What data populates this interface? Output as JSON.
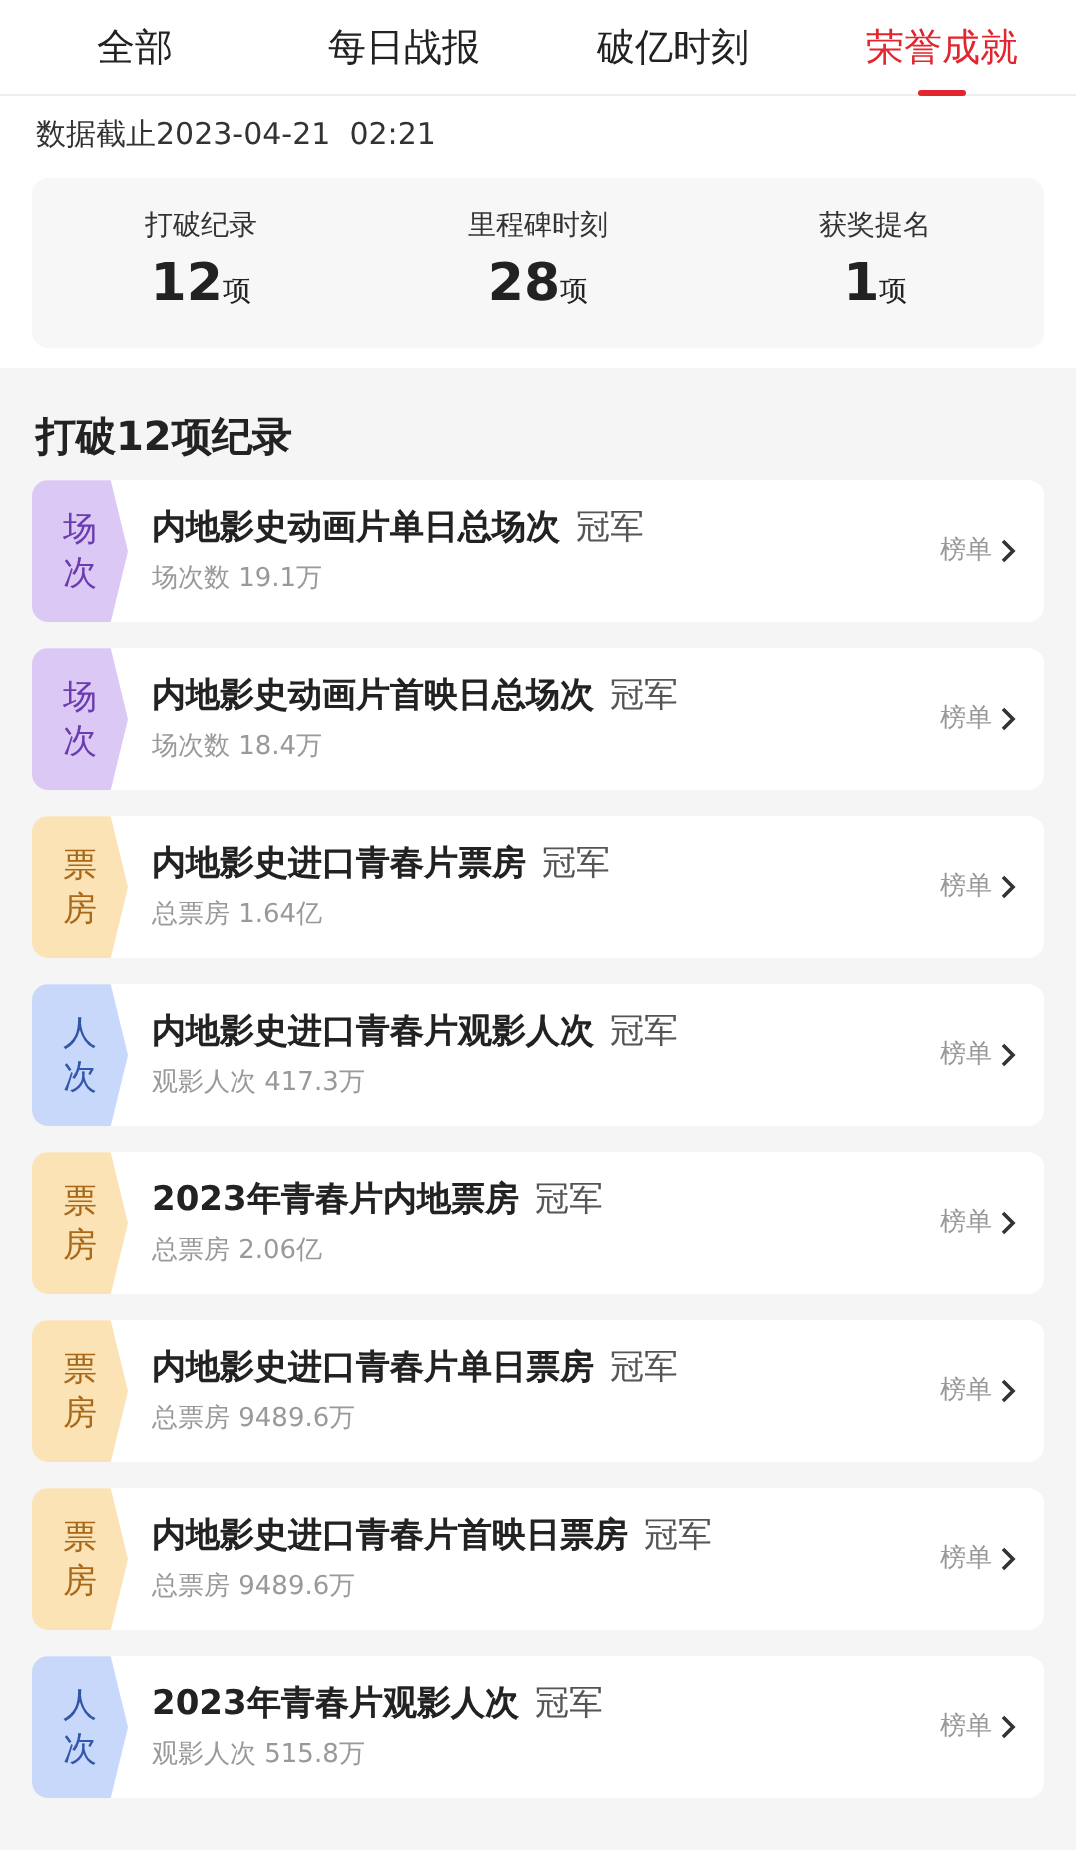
{
  "tabs": [
    {
      "label": "全部",
      "selected": false
    },
    {
      "label": "每日战报",
      "selected": false
    },
    {
      "label": "破亿时刻",
      "selected": false
    },
    {
      "label": "荣誉成就",
      "selected": true
    }
  ],
  "data_cutoff": "数据截止2023-04-21  02:21",
  "stats": [
    {
      "label": "打破纪录",
      "value": "12",
      "unit": "项"
    },
    {
      "label": "里程碑时刻",
      "value": "28",
      "unit": "项"
    },
    {
      "label": "获奖提名",
      "value": "1",
      "unit": "项"
    }
  ],
  "section_title": "打破12项纪录",
  "records": [
    {
      "kind": "screenings",
      "tag": "场次",
      "title": "内地影史动画片单日总场次",
      "rank": "冠军",
      "detail": "场次数 19.1万",
      "link": "榜单"
    },
    {
      "kind": "screenings",
      "tag": "场次",
      "title": "内地影史动画片首映日总场次",
      "rank": "冠军",
      "detail": "场次数 18.4万",
      "link": "榜单"
    },
    {
      "kind": "boxoffice",
      "tag": "票房",
      "title": "内地影史进口青春片票房",
      "rank": "冠军",
      "detail": "总票房 1.64亿",
      "link": "榜单"
    },
    {
      "kind": "admissions",
      "tag": "人次",
      "title": "内地影史进口青春片观影人次",
      "rank": "冠军",
      "detail": "观影人次 417.3万",
      "link": "榜单"
    },
    {
      "kind": "boxoffice",
      "tag": "票房",
      "title": "2023年青春片内地票房",
      "rank": "冠军",
      "detail": "总票房 2.06亿",
      "link": "榜单"
    },
    {
      "kind": "boxoffice",
      "tag": "票房",
      "title": "内地影史进口青春片单日票房",
      "rank": "冠军",
      "detail": "总票房 9489.6万",
      "link": "榜单"
    },
    {
      "kind": "boxoffice",
      "tag": "票房",
      "title": "内地影史进口青春片首映日票房",
      "rank": "冠军",
      "detail": "总票房 9489.6万",
      "link": "榜单"
    },
    {
      "kind": "admissions",
      "tag": "人次",
      "title": "2023年青春片观影人次",
      "rank": "冠军",
      "detail": "观影人次 515.8万",
      "link": "榜单"
    }
  ]
}
